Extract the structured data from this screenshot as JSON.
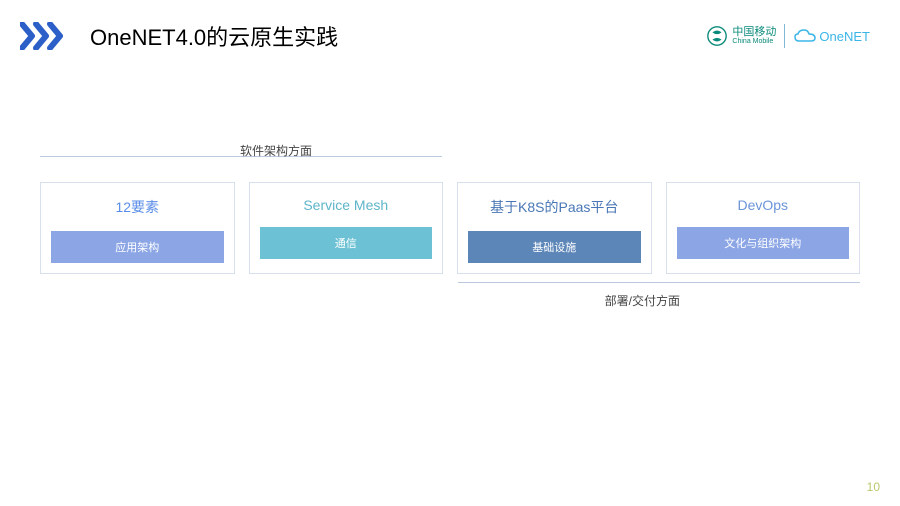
{
  "header": {
    "title": "OneNET4.0的云原生实践",
    "logo_cm_cn": "中国移动",
    "logo_cm_en": "China Mobile",
    "logo_onenet": "OneNET"
  },
  "sections": {
    "top_label": "软件架构方面",
    "bottom_label": "部署/交付方面"
  },
  "cards": [
    {
      "title": "12要素",
      "subtitle": "应用架构"
    },
    {
      "title": "Service Mesh",
      "subtitle": "通信"
    },
    {
      "title": "基于K8S的Paas平台",
      "subtitle": "基础设施"
    },
    {
      "title": "DevOps",
      "subtitle": "文化与组织架构"
    }
  ],
  "page_number": "10"
}
